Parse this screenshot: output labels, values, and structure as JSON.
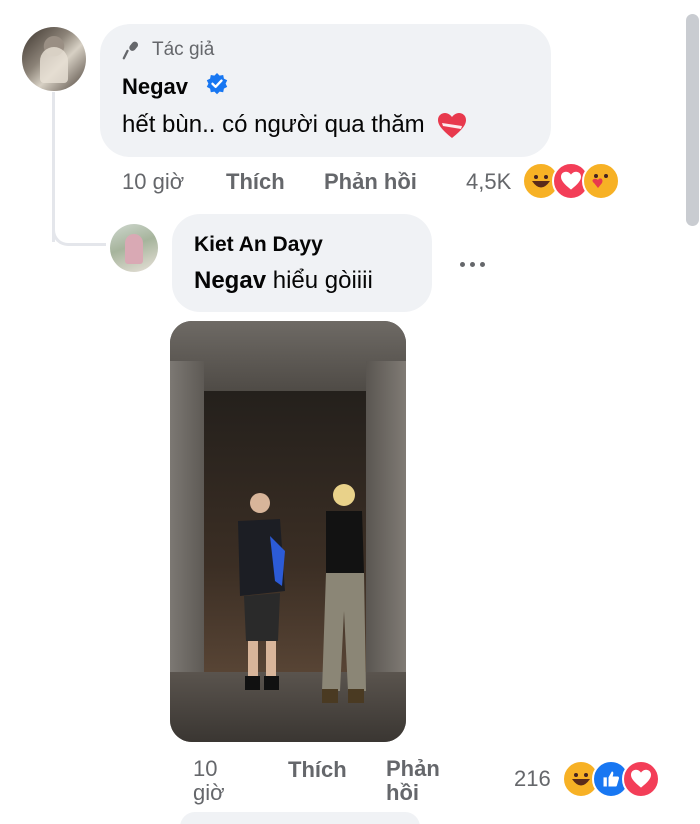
{
  "comment": {
    "author_badge": "Tác giả",
    "author": "Negav",
    "text": "hết bùn.. có người qua thăm",
    "time": "10 giờ",
    "like_label": "Thích",
    "reply_label": "Phản hồi",
    "reaction_count": "4,5K",
    "reactions": [
      "haha-icon",
      "love-icon",
      "care-icon"
    ]
  },
  "reply": {
    "author": "Kiet An Dayy",
    "mention": "Negav",
    "text": " hiểu gòiiii",
    "time_line1": "10",
    "time_line2": "giờ",
    "like_label": "Thích",
    "reply_line1": "Phản",
    "reply_line2": "hồi",
    "reaction_count": "216",
    "reactions": [
      "haha-icon",
      "like-icon",
      "love-icon"
    ]
  },
  "colors": {
    "bubble": "#f0f2f5",
    "meta_text": "#65676b",
    "verified": "#1877f2",
    "love": "#f33e58",
    "haha": "#f7b125"
  }
}
